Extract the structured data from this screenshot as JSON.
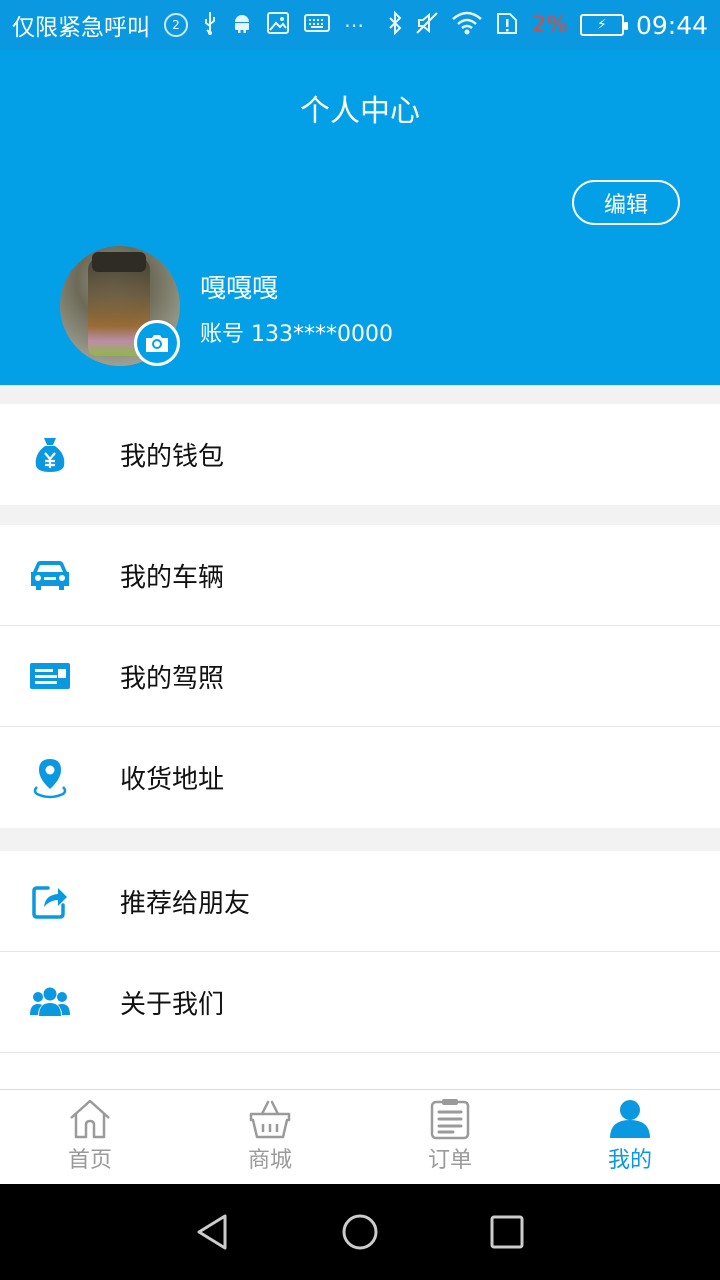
{
  "status_bar": {
    "carrier": "仅限紧急呼叫",
    "notification_count": "2",
    "battery_percent": "2%",
    "time": "09:44",
    "icons": [
      "usb-icon",
      "android-icon",
      "image-icon",
      "keyboard-icon",
      "more-icon",
      "bluetooth-icon",
      "mute-icon",
      "wifi-icon",
      "sim-alert-icon",
      "battery-charging-icon"
    ]
  },
  "header": {
    "title": "个人中心",
    "edit_label": "编辑",
    "user_name": "嘎嘎嘎",
    "account": "账号 133****0000",
    "background_color": "#03a0e8"
  },
  "menu": {
    "groups": [
      {
        "items": [
          {
            "label": "我的钱包",
            "icon": "wallet-icon"
          }
        ]
      },
      {
        "items": [
          {
            "label": "我的车辆",
            "icon": "car-icon"
          },
          {
            "label": "我的驾照",
            "icon": "license-icon"
          },
          {
            "label": "收货地址",
            "icon": "location-icon"
          }
        ]
      },
      {
        "items": [
          {
            "label": "推荐给朋友",
            "icon": "share-icon"
          },
          {
            "label": "关于我们",
            "icon": "group-icon"
          }
        ]
      }
    ],
    "icon_color": "#0a98e0"
  },
  "bottom_nav": {
    "items": [
      {
        "label": "首页",
        "icon": "home-icon",
        "active": false
      },
      {
        "label": "商城",
        "icon": "basket-icon",
        "active": false
      },
      {
        "label": "订单",
        "icon": "clipboard-icon",
        "active": false
      },
      {
        "label": "我的",
        "icon": "person-icon",
        "active": true
      }
    ],
    "active_color": "#0a98e0",
    "inactive_color": "#9a9a9a"
  },
  "system_nav": {
    "icons": [
      "back-icon",
      "home-circle-icon",
      "recents-icon"
    ]
  }
}
